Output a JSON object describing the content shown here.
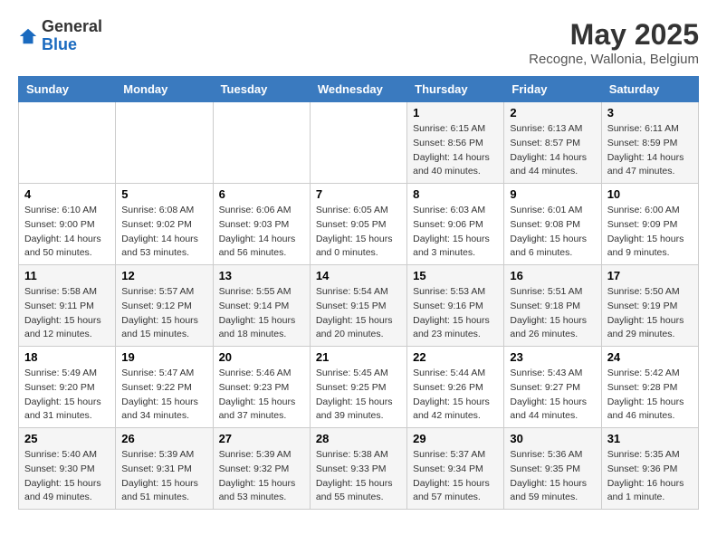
{
  "header": {
    "logo_general": "General",
    "logo_blue": "Blue",
    "month_title": "May 2025",
    "location": "Recogne, Wallonia, Belgium"
  },
  "weekdays": [
    "Sunday",
    "Monday",
    "Tuesday",
    "Wednesday",
    "Thursday",
    "Friday",
    "Saturday"
  ],
  "weeks": [
    [
      {
        "day": "",
        "info": ""
      },
      {
        "day": "",
        "info": ""
      },
      {
        "day": "",
        "info": ""
      },
      {
        "day": "",
        "info": ""
      },
      {
        "day": "1",
        "info": "Sunrise: 6:15 AM\nSunset: 8:56 PM\nDaylight: 14 hours\nand 40 minutes."
      },
      {
        "day": "2",
        "info": "Sunrise: 6:13 AM\nSunset: 8:57 PM\nDaylight: 14 hours\nand 44 minutes."
      },
      {
        "day": "3",
        "info": "Sunrise: 6:11 AM\nSunset: 8:59 PM\nDaylight: 14 hours\nand 47 minutes."
      }
    ],
    [
      {
        "day": "4",
        "info": "Sunrise: 6:10 AM\nSunset: 9:00 PM\nDaylight: 14 hours\nand 50 minutes."
      },
      {
        "day": "5",
        "info": "Sunrise: 6:08 AM\nSunset: 9:02 PM\nDaylight: 14 hours\nand 53 minutes."
      },
      {
        "day": "6",
        "info": "Sunrise: 6:06 AM\nSunset: 9:03 PM\nDaylight: 14 hours\nand 56 minutes."
      },
      {
        "day": "7",
        "info": "Sunrise: 6:05 AM\nSunset: 9:05 PM\nDaylight: 15 hours\nand 0 minutes."
      },
      {
        "day": "8",
        "info": "Sunrise: 6:03 AM\nSunset: 9:06 PM\nDaylight: 15 hours\nand 3 minutes."
      },
      {
        "day": "9",
        "info": "Sunrise: 6:01 AM\nSunset: 9:08 PM\nDaylight: 15 hours\nand 6 minutes."
      },
      {
        "day": "10",
        "info": "Sunrise: 6:00 AM\nSunset: 9:09 PM\nDaylight: 15 hours\nand 9 minutes."
      }
    ],
    [
      {
        "day": "11",
        "info": "Sunrise: 5:58 AM\nSunset: 9:11 PM\nDaylight: 15 hours\nand 12 minutes."
      },
      {
        "day": "12",
        "info": "Sunrise: 5:57 AM\nSunset: 9:12 PM\nDaylight: 15 hours\nand 15 minutes."
      },
      {
        "day": "13",
        "info": "Sunrise: 5:55 AM\nSunset: 9:14 PM\nDaylight: 15 hours\nand 18 minutes."
      },
      {
        "day": "14",
        "info": "Sunrise: 5:54 AM\nSunset: 9:15 PM\nDaylight: 15 hours\nand 20 minutes."
      },
      {
        "day": "15",
        "info": "Sunrise: 5:53 AM\nSunset: 9:16 PM\nDaylight: 15 hours\nand 23 minutes."
      },
      {
        "day": "16",
        "info": "Sunrise: 5:51 AM\nSunset: 9:18 PM\nDaylight: 15 hours\nand 26 minutes."
      },
      {
        "day": "17",
        "info": "Sunrise: 5:50 AM\nSunset: 9:19 PM\nDaylight: 15 hours\nand 29 minutes."
      }
    ],
    [
      {
        "day": "18",
        "info": "Sunrise: 5:49 AM\nSunset: 9:20 PM\nDaylight: 15 hours\nand 31 minutes."
      },
      {
        "day": "19",
        "info": "Sunrise: 5:47 AM\nSunset: 9:22 PM\nDaylight: 15 hours\nand 34 minutes."
      },
      {
        "day": "20",
        "info": "Sunrise: 5:46 AM\nSunset: 9:23 PM\nDaylight: 15 hours\nand 37 minutes."
      },
      {
        "day": "21",
        "info": "Sunrise: 5:45 AM\nSunset: 9:25 PM\nDaylight: 15 hours\nand 39 minutes."
      },
      {
        "day": "22",
        "info": "Sunrise: 5:44 AM\nSunset: 9:26 PM\nDaylight: 15 hours\nand 42 minutes."
      },
      {
        "day": "23",
        "info": "Sunrise: 5:43 AM\nSunset: 9:27 PM\nDaylight: 15 hours\nand 44 minutes."
      },
      {
        "day": "24",
        "info": "Sunrise: 5:42 AM\nSunset: 9:28 PM\nDaylight: 15 hours\nand 46 minutes."
      }
    ],
    [
      {
        "day": "25",
        "info": "Sunrise: 5:40 AM\nSunset: 9:30 PM\nDaylight: 15 hours\nand 49 minutes."
      },
      {
        "day": "26",
        "info": "Sunrise: 5:39 AM\nSunset: 9:31 PM\nDaylight: 15 hours\nand 51 minutes."
      },
      {
        "day": "27",
        "info": "Sunrise: 5:39 AM\nSunset: 9:32 PM\nDaylight: 15 hours\nand 53 minutes."
      },
      {
        "day": "28",
        "info": "Sunrise: 5:38 AM\nSunset: 9:33 PM\nDaylight: 15 hours\nand 55 minutes."
      },
      {
        "day": "29",
        "info": "Sunrise: 5:37 AM\nSunset: 9:34 PM\nDaylight: 15 hours\nand 57 minutes."
      },
      {
        "day": "30",
        "info": "Sunrise: 5:36 AM\nSunset: 9:35 PM\nDaylight: 15 hours\nand 59 minutes."
      },
      {
        "day": "31",
        "info": "Sunrise: 5:35 AM\nSunset: 9:36 PM\nDaylight: 16 hours\nand 1 minute."
      }
    ]
  ]
}
